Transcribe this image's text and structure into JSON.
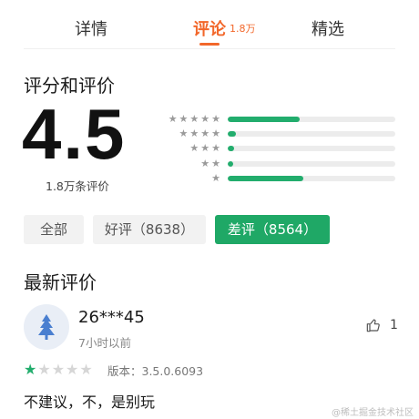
{
  "tabs": [
    {
      "label": "详情"
    },
    {
      "label": "评论",
      "count": "1.8万"
    },
    {
      "label": "精选"
    }
  ],
  "rating": {
    "title": "评分和评价",
    "score": "4.5",
    "count_text": "1.8万条评价",
    "distribution": [
      {
        "stars": 5,
        "fraction": 0.43
      },
      {
        "stars": 4,
        "fraction": 0.05
      },
      {
        "stars": 3,
        "fraction": 0.04
      },
      {
        "stars": 2,
        "fraction": 0.03
      },
      {
        "stars": 1,
        "fraction": 0.45
      }
    ],
    "bar_color": "#22ad6d"
  },
  "filters": [
    {
      "label": "全部",
      "active": false
    },
    {
      "label": "好评（8638）",
      "active": false
    },
    {
      "label": "差评（8564）",
      "active": true
    }
  ],
  "latest": {
    "title": "最新评价",
    "review": {
      "username": "26***45",
      "time": "7小时以前",
      "likes": "1",
      "rating": 1,
      "version": "版本：3.5.0.6093",
      "text": "不建议，不，是别玩"
    }
  },
  "watermark": "@稀土掘金技术社区",
  "colors": {
    "accent": "#f2672a",
    "green": "#1fa866"
  }
}
